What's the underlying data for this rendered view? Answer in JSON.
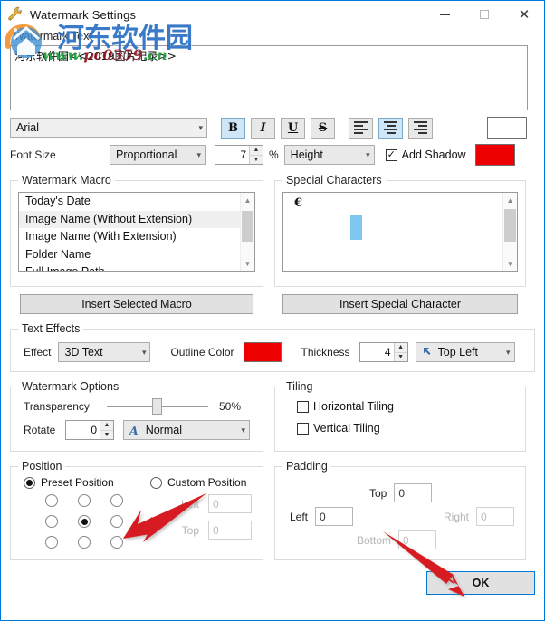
{
  "window": {
    "title": "Watermark Settings",
    "icon": "wrench-icon",
    "minimize": "─",
    "maximize": "□",
    "close": "✕",
    "accent": "#0078d7"
  },
  "watermark_overlay": {
    "chinese_text": "河东软件园",
    "url_prefix": "www.",
    "url_mid": "pc0359",
    "url_suffix": ".cn",
    "color_blue": "#2a6fc4",
    "color_green": "#1f9b3f",
    "color_red": "#8c1420"
  },
  "watermark_text": {
    "label": "Watermark Text",
    "value": "河东软件园<<2019图片记录>>",
    "placeholder": ""
  },
  "font_row": {
    "font_family": "Arial",
    "bold": "B",
    "italic": "I",
    "underline": "U",
    "strike": "S",
    "align_left": "align-left",
    "align_center": "align-center",
    "align_right": "align-right",
    "bold_active": true,
    "align_center_active": true,
    "text_color": "#ffffff"
  },
  "font_size_row": {
    "label": "Font Size",
    "mode": "Proportional",
    "size_value": "7",
    "percent": "%",
    "basis": "Height",
    "add_shadow_label": "Add Shadow",
    "add_shadow_checked": true,
    "shadow_color": "#ee0000"
  },
  "watermark_macro": {
    "title": "Watermark Macro",
    "items": [
      "Today's Date",
      "Image Name (Without Extension)",
      "Image Name (With Extension)",
      "Folder Name",
      "Full Image Path"
    ],
    "selected_index": 1,
    "button": "Insert Selected Macro"
  },
  "special_characters": {
    "title": "Special Characters",
    "items": [
      "€"
    ],
    "selected_glyph": "",
    "button": "Insert Special Character",
    "highlight_color": "#7ec8ef"
  },
  "text_effects": {
    "title": "Text Effects",
    "effect_label": "Effect",
    "effect_value": "3D Text",
    "outline_color_label": "Outline Color",
    "outline_color": "#ee0000",
    "thickness_label": "Thickness",
    "thickness_value": "4",
    "direction_value": "Top Left"
  },
  "watermark_options": {
    "title": "Watermark Options",
    "transparency_label": "Transparency",
    "transparency_value": "50%",
    "transparency_percent": 50,
    "rotate_label": "Rotate",
    "rotate_value": "0",
    "style_value": "Normal",
    "style_icon": "A"
  },
  "tiling": {
    "title": "Tiling",
    "horizontal_label": "Horizontal Tiling",
    "horizontal_checked": false,
    "vertical_label": "Vertical Tiling",
    "vertical_checked": false
  },
  "position": {
    "title": "Position",
    "preset_label": "Preset Position",
    "preset_selected": true,
    "custom_label": "Custom Position",
    "custom_selected": false,
    "grid_selected_index": 4,
    "left_label": "Left",
    "left_value": "0",
    "top_label": "Top",
    "top_value": "0"
  },
  "padding": {
    "title": "Padding",
    "top_label": "Top",
    "top_value": "0",
    "left_label": "Left",
    "left_value": "0",
    "right_label": "Right",
    "right_value": "0",
    "bottom_label": "Bottom",
    "bottom_value": "0"
  },
  "footer": {
    "ok_label": "OK"
  },
  "annotations": {
    "arrow_color": "#d61f20",
    "arrow1_target": "position-grid-middle-right-radio",
    "arrow2_target": "ok-button"
  }
}
